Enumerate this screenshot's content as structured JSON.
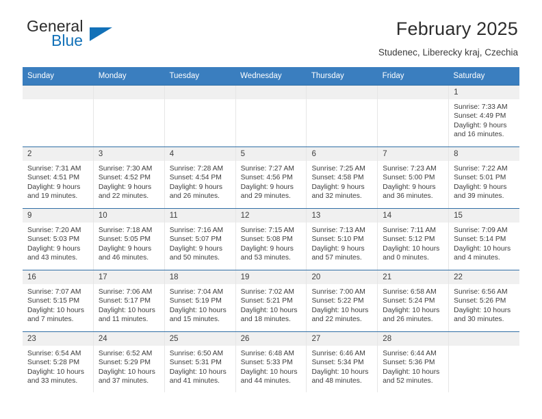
{
  "brand": {
    "name_part1": "General",
    "name_part2": "Blue",
    "triangle_color": "#1271b8"
  },
  "header": {
    "title": "February 2025",
    "subtitle": "Studenec, Liberecky kraj, Czechia"
  },
  "theme": {
    "header_bg": "#3a7ebf",
    "row_line": "#2e6da4",
    "daynum_bg": "#f0f0f0",
    "text": "#3c3c3c"
  },
  "day_headers": [
    "Sunday",
    "Monday",
    "Tuesday",
    "Wednesday",
    "Thursday",
    "Friday",
    "Saturday"
  ],
  "weeks": [
    [
      {
        "day": "",
        "empty": true,
        "sunrise": "",
        "sunset": "",
        "daylight1": "",
        "daylight2": ""
      },
      {
        "day": "",
        "empty": true,
        "sunrise": "",
        "sunset": "",
        "daylight1": "",
        "daylight2": ""
      },
      {
        "day": "",
        "empty": true,
        "sunrise": "",
        "sunset": "",
        "daylight1": "",
        "daylight2": ""
      },
      {
        "day": "",
        "empty": true,
        "sunrise": "",
        "sunset": "",
        "daylight1": "",
        "daylight2": ""
      },
      {
        "day": "",
        "empty": true,
        "sunrise": "",
        "sunset": "",
        "daylight1": "",
        "daylight2": ""
      },
      {
        "day": "",
        "empty": true,
        "sunrise": "",
        "sunset": "",
        "daylight1": "",
        "daylight2": ""
      },
      {
        "day": "1",
        "empty": false,
        "sunrise": "Sunrise: 7:33 AM",
        "sunset": "Sunset: 4:49 PM",
        "daylight1": "Daylight: 9 hours",
        "daylight2": "and 16 minutes."
      }
    ],
    [
      {
        "day": "2",
        "empty": false,
        "sunrise": "Sunrise: 7:31 AM",
        "sunset": "Sunset: 4:51 PM",
        "daylight1": "Daylight: 9 hours",
        "daylight2": "and 19 minutes."
      },
      {
        "day": "3",
        "empty": false,
        "sunrise": "Sunrise: 7:30 AM",
        "sunset": "Sunset: 4:52 PM",
        "daylight1": "Daylight: 9 hours",
        "daylight2": "and 22 minutes."
      },
      {
        "day": "4",
        "empty": false,
        "sunrise": "Sunrise: 7:28 AM",
        "sunset": "Sunset: 4:54 PM",
        "daylight1": "Daylight: 9 hours",
        "daylight2": "and 26 minutes."
      },
      {
        "day": "5",
        "empty": false,
        "sunrise": "Sunrise: 7:27 AM",
        "sunset": "Sunset: 4:56 PM",
        "daylight1": "Daylight: 9 hours",
        "daylight2": "and 29 minutes."
      },
      {
        "day": "6",
        "empty": false,
        "sunrise": "Sunrise: 7:25 AM",
        "sunset": "Sunset: 4:58 PM",
        "daylight1": "Daylight: 9 hours",
        "daylight2": "and 32 minutes."
      },
      {
        "day": "7",
        "empty": false,
        "sunrise": "Sunrise: 7:23 AM",
        "sunset": "Sunset: 5:00 PM",
        "daylight1": "Daylight: 9 hours",
        "daylight2": "and 36 minutes."
      },
      {
        "day": "8",
        "empty": false,
        "sunrise": "Sunrise: 7:22 AM",
        "sunset": "Sunset: 5:01 PM",
        "daylight1": "Daylight: 9 hours",
        "daylight2": "and 39 minutes."
      }
    ],
    [
      {
        "day": "9",
        "empty": false,
        "sunrise": "Sunrise: 7:20 AM",
        "sunset": "Sunset: 5:03 PM",
        "daylight1": "Daylight: 9 hours",
        "daylight2": "and 43 minutes."
      },
      {
        "day": "10",
        "empty": false,
        "sunrise": "Sunrise: 7:18 AM",
        "sunset": "Sunset: 5:05 PM",
        "daylight1": "Daylight: 9 hours",
        "daylight2": "and 46 minutes."
      },
      {
        "day": "11",
        "empty": false,
        "sunrise": "Sunrise: 7:16 AM",
        "sunset": "Sunset: 5:07 PM",
        "daylight1": "Daylight: 9 hours",
        "daylight2": "and 50 minutes."
      },
      {
        "day": "12",
        "empty": false,
        "sunrise": "Sunrise: 7:15 AM",
        "sunset": "Sunset: 5:08 PM",
        "daylight1": "Daylight: 9 hours",
        "daylight2": "and 53 minutes."
      },
      {
        "day": "13",
        "empty": false,
        "sunrise": "Sunrise: 7:13 AM",
        "sunset": "Sunset: 5:10 PM",
        "daylight1": "Daylight: 9 hours",
        "daylight2": "and 57 minutes."
      },
      {
        "day": "14",
        "empty": false,
        "sunrise": "Sunrise: 7:11 AM",
        "sunset": "Sunset: 5:12 PM",
        "daylight1": "Daylight: 10 hours",
        "daylight2": "and 0 minutes."
      },
      {
        "day": "15",
        "empty": false,
        "sunrise": "Sunrise: 7:09 AM",
        "sunset": "Sunset: 5:14 PM",
        "daylight1": "Daylight: 10 hours",
        "daylight2": "and 4 minutes."
      }
    ],
    [
      {
        "day": "16",
        "empty": false,
        "sunrise": "Sunrise: 7:07 AM",
        "sunset": "Sunset: 5:15 PM",
        "daylight1": "Daylight: 10 hours",
        "daylight2": "and 7 minutes."
      },
      {
        "day": "17",
        "empty": false,
        "sunrise": "Sunrise: 7:06 AM",
        "sunset": "Sunset: 5:17 PM",
        "daylight1": "Daylight: 10 hours",
        "daylight2": "and 11 minutes."
      },
      {
        "day": "18",
        "empty": false,
        "sunrise": "Sunrise: 7:04 AM",
        "sunset": "Sunset: 5:19 PM",
        "daylight1": "Daylight: 10 hours",
        "daylight2": "and 15 minutes."
      },
      {
        "day": "19",
        "empty": false,
        "sunrise": "Sunrise: 7:02 AM",
        "sunset": "Sunset: 5:21 PM",
        "daylight1": "Daylight: 10 hours",
        "daylight2": "and 18 minutes."
      },
      {
        "day": "20",
        "empty": false,
        "sunrise": "Sunrise: 7:00 AM",
        "sunset": "Sunset: 5:22 PM",
        "daylight1": "Daylight: 10 hours",
        "daylight2": "and 22 minutes."
      },
      {
        "day": "21",
        "empty": false,
        "sunrise": "Sunrise: 6:58 AM",
        "sunset": "Sunset: 5:24 PM",
        "daylight1": "Daylight: 10 hours",
        "daylight2": "and 26 minutes."
      },
      {
        "day": "22",
        "empty": false,
        "sunrise": "Sunrise: 6:56 AM",
        "sunset": "Sunset: 5:26 PM",
        "daylight1": "Daylight: 10 hours",
        "daylight2": "and 30 minutes."
      }
    ],
    [
      {
        "day": "23",
        "empty": false,
        "sunrise": "Sunrise: 6:54 AM",
        "sunset": "Sunset: 5:28 PM",
        "daylight1": "Daylight: 10 hours",
        "daylight2": "and 33 minutes."
      },
      {
        "day": "24",
        "empty": false,
        "sunrise": "Sunrise: 6:52 AM",
        "sunset": "Sunset: 5:29 PM",
        "daylight1": "Daylight: 10 hours",
        "daylight2": "and 37 minutes."
      },
      {
        "day": "25",
        "empty": false,
        "sunrise": "Sunrise: 6:50 AM",
        "sunset": "Sunset: 5:31 PM",
        "daylight1": "Daylight: 10 hours",
        "daylight2": "and 41 minutes."
      },
      {
        "day": "26",
        "empty": false,
        "sunrise": "Sunrise: 6:48 AM",
        "sunset": "Sunset: 5:33 PM",
        "daylight1": "Daylight: 10 hours",
        "daylight2": "and 44 minutes."
      },
      {
        "day": "27",
        "empty": false,
        "sunrise": "Sunrise: 6:46 AM",
        "sunset": "Sunset: 5:34 PM",
        "daylight1": "Daylight: 10 hours",
        "daylight2": "and 48 minutes."
      },
      {
        "day": "28",
        "empty": false,
        "sunrise": "Sunrise: 6:44 AM",
        "sunset": "Sunset: 5:36 PM",
        "daylight1": "Daylight: 10 hours",
        "daylight2": "and 52 minutes."
      },
      {
        "day": "",
        "empty": true,
        "sunrise": "",
        "sunset": "",
        "daylight1": "",
        "daylight2": ""
      }
    ]
  ]
}
